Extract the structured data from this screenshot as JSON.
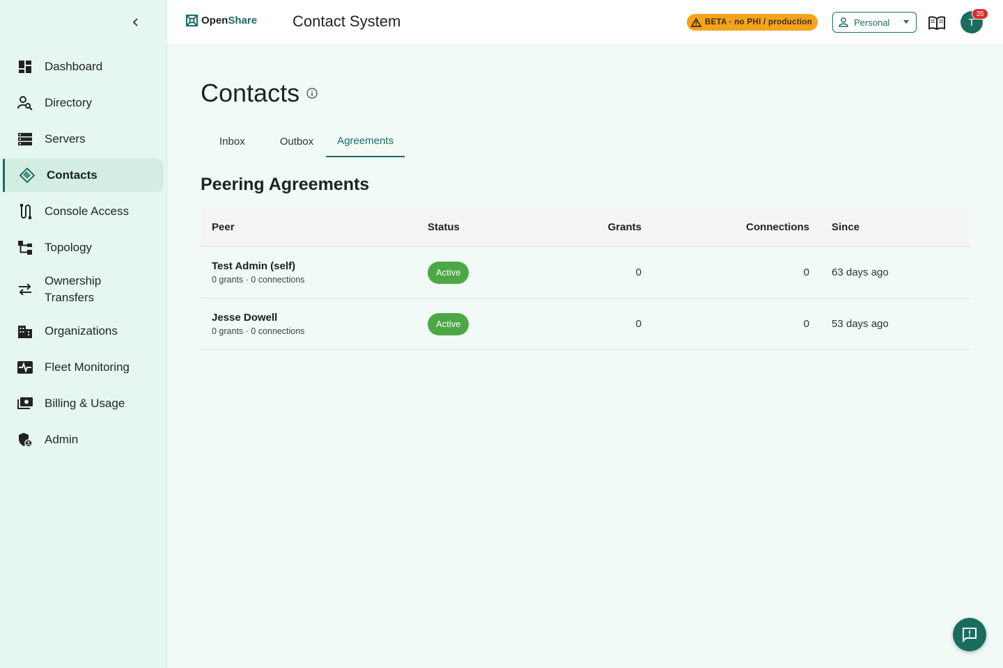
{
  "colors": {
    "accent": "#1a6c5f",
    "beta": "#f4a31d",
    "status_active": "#4ca847",
    "notification": "#d92d27"
  },
  "sidebar": {
    "items": [
      {
        "label": "Dashboard",
        "icon": "dashboard-icon"
      },
      {
        "label": "Directory",
        "icon": "person-search-icon"
      },
      {
        "label": "Servers",
        "icon": "server-icon"
      },
      {
        "label": "Contacts",
        "icon": "handshake-icon",
        "active": true
      },
      {
        "label": "Console Access",
        "icon": "cable-icon"
      },
      {
        "label": "Topology",
        "icon": "tree-icon"
      },
      {
        "label": "Ownership Transfers",
        "icon": "swap-icon"
      },
      {
        "label": "Organizations",
        "icon": "building-icon"
      },
      {
        "label": "Fleet Monitoring",
        "icon": "monitor-heart-icon"
      },
      {
        "label": "Billing & Usage",
        "icon": "payments-icon"
      },
      {
        "label": "Admin",
        "icon": "admin-shield-icon"
      }
    ]
  },
  "header": {
    "brand_part1": "Open",
    "brand_part2": "Share",
    "title": "Contact System",
    "beta_label": "BETA · no PHI / production",
    "workspace_select": "Personal",
    "avatar_initial": "T",
    "notification_count": "35"
  },
  "main": {
    "page_title": "Contacts",
    "tabs": [
      {
        "label": "Inbox"
      },
      {
        "label": "Outbox"
      },
      {
        "label": "Agreements",
        "active": true
      }
    ],
    "section_title": "Peering Agreements",
    "table": {
      "headers": {
        "peer": "Peer",
        "status": "Status",
        "grants": "Grants",
        "connections": "Connections",
        "since": "Since"
      },
      "rows": [
        {
          "peer": "Test Admin (self)",
          "summary": "0 grants · 0 connections",
          "status": "Active",
          "grants": "0",
          "connections": "0",
          "since": "63 days ago"
        },
        {
          "peer": "Jesse Dowell",
          "summary": "0 grants · 0 connections",
          "status": "Active",
          "grants": "0",
          "connections": "0",
          "since": "53 days ago"
        }
      ]
    }
  }
}
